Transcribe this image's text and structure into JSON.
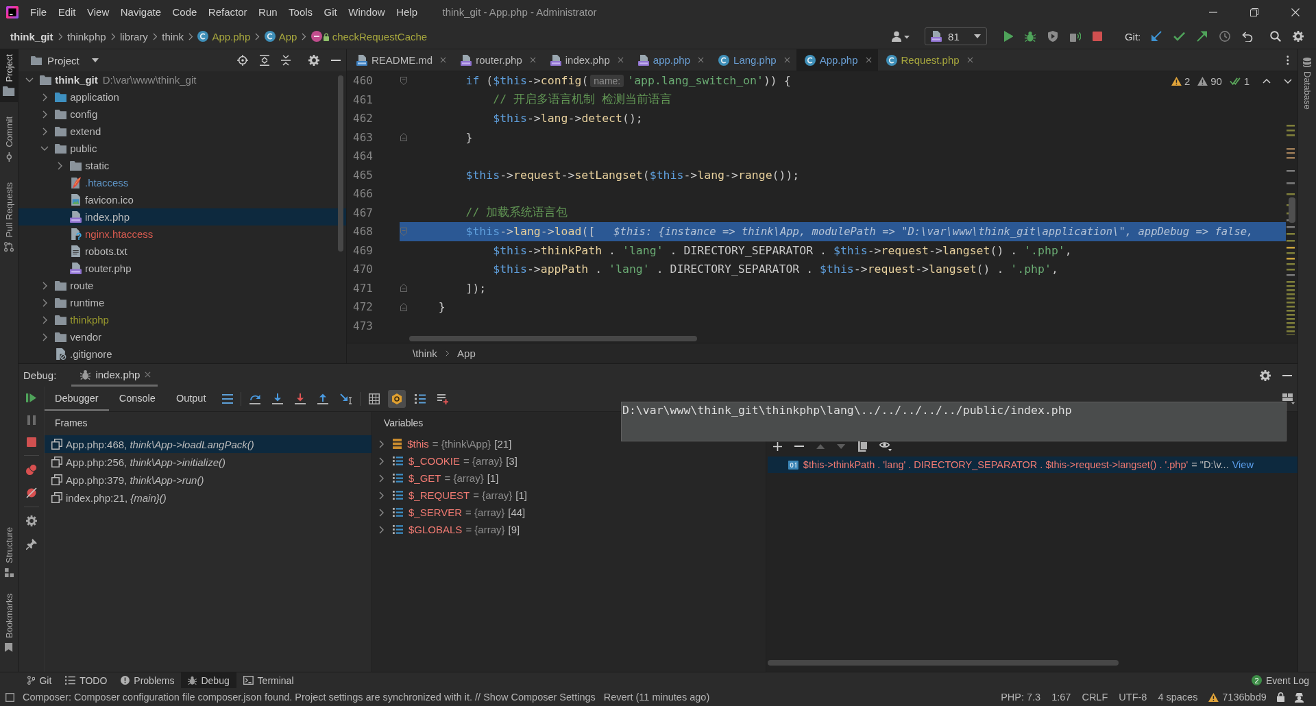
{
  "title_bar": {
    "menu": [
      "File",
      "Edit",
      "View",
      "Navigate",
      "Code",
      "Refactor",
      "Run",
      "Tools",
      "Git",
      "Window",
      "Help"
    ],
    "title": "think_git - App.php - Administrator"
  },
  "nav_bar": {
    "breadcrumbs": [
      {
        "label": "think_git",
        "kind": "project",
        "color": "#d4d4d4"
      },
      {
        "label": "thinkphp",
        "kind": "folder",
        "color": "#bbbbbb"
      },
      {
        "label": "library",
        "kind": "folder",
        "color": "#bbbbbb"
      },
      {
        "label": "think",
        "kind": "folder",
        "color": "#bbbbbb"
      },
      {
        "label": "App.php",
        "kind": "class",
        "color": "#a8a83e"
      },
      {
        "label": "App",
        "kind": "class",
        "color": "#a8a83e"
      },
      {
        "label": "checkRequestCache",
        "kind": "method",
        "color": "#a8a83e"
      }
    ],
    "run_config": "81",
    "vcs_label": "Git:"
  },
  "left_strip": {
    "top": [
      {
        "label": "Project",
        "selected": true
      },
      {
        "label": "Commit",
        "selected": false
      },
      {
        "label": "Pull Requests",
        "selected": false
      }
    ],
    "bottom": [
      {
        "label": "Structure",
        "selected": false
      },
      {
        "label": "Bookmarks",
        "selected": false
      }
    ]
  },
  "right_strip": [
    {
      "label": "Database",
      "selected": false
    }
  ],
  "project": {
    "title": "Project",
    "tree": [
      {
        "label": "think_git",
        "path": "D:\\var\\www\\think_git",
        "kind": "project",
        "color": "#d4d4d4",
        "selected": false,
        "expanded": true,
        "children": [
          {
            "label": "application",
            "kind": "source-folder",
            "color": "#bbbbbb",
            "selected": false,
            "expanded": false
          },
          {
            "label": "config",
            "kind": "folder",
            "color": "#bbbbbb",
            "selected": false,
            "expanded": false
          },
          {
            "label": "extend",
            "kind": "folder",
            "color": "#bbbbbb",
            "selected": false,
            "expanded": false
          },
          {
            "label": "public",
            "kind": "folder",
            "color": "#bbbbbb",
            "selected": false,
            "expanded": true,
            "children": [
              {
                "label": "static",
                "kind": "folder",
                "color": "#bbbbbb",
                "selected": false,
                "expanded": false
              },
              {
                "label": ".htaccess",
                "kind": "apache-config",
                "color": "#5f96c8",
                "selected": false
              },
              {
                "label": "favicon.ico",
                "kind": "image",
                "color": "#bbbbbb",
                "selected": false
              },
              {
                "label": "index.php",
                "kind": "php",
                "color": "#bbbbbb",
                "selected": true
              },
              {
                "label": "nginx.htaccess",
                "kind": "unknown",
                "color": "#d95b50",
                "selected": false
              },
              {
                "label": "robots.txt",
                "kind": "text",
                "color": "#bbbbbb",
                "selected": false
              },
              {
                "label": "router.php",
                "kind": "php",
                "color": "#bbbbbb",
                "selected": false
              }
            ]
          },
          {
            "label": "route",
            "kind": "folder",
            "color": "#bbbbbb",
            "selected": false,
            "expanded": false
          },
          {
            "label": "runtime",
            "kind": "folder",
            "color": "#bbbbbb",
            "selected": false,
            "expanded": false
          },
          {
            "label": "thinkphp",
            "kind": "folder",
            "color": "#9a9a2e",
            "selected": false,
            "expanded": false
          },
          {
            "label": "vendor",
            "kind": "folder",
            "color": "#bbbbbb",
            "selected": false,
            "expanded": false
          },
          {
            "label": ".gitignore",
            "kind": "ignore",
            "color": "#bbbbbb",
            "selected": false
          }
        ]
      }
    ]
  },
  "editor": {
    "tabs": [
      {
        "label": "README.md",
        "kind": "markdown",
        "color": "#bbbbbb",
        "selected": false
      },
      {
        "label": "router.php",
        "kind": "php",
        "color": "#bbbbbb",
        "selected": false
      },
      {
        "label": "index.php",
        "kind": "php",
        "color": "#bbbbbb",
        "selected": false
      },
      {
        "label": "app.php",
        "kind": "php",
        "color": "#6a9fd4",
        "selected": false
      },
      {
        "label": "Lang.php",
        "kind": "class",
        "color": "#6a9fd4",
        "selected": false
      },
      {
        "label": "App.php",
        "kind": "class",
        "color": "#6a9fd4",
        "selected": true
      },
      {
        "label": "Request.php",
        "kind": "class",
        "color": "#a8a83e",
        "selected": false
      }
    ],
    "code": [
      {
        "children": [
          {
            "number": "460",
            "current": false,
            "fold_end": false,
            "tokens": [
              {
                "kind": "keyword",
                "text": "if"
              },
              {
                "kind": "punct",
                "text": " ("
              },
              {
                "kind": "variable",
                "text": "$this"
              },
              {
                "kind": "arrow",
                "text": "->"
              },
              {
                "kind": "member",
                "text": "config"
              },
              {
                "kind": "punct",
                "text": "("
              },
              {
                "kind": "hint",
                "text": "name:"
              },
              {
                "kind": "string",
                "text": "'app.lang_switch_on'"
              },
              {
                "kind": "punct",
                "text": ")) {"
              }
            ],
            "children": [
              {
                "number": "461",
                "current": false,
                "fold_end": false,
                "tokens": [
                  {
                    "kind": "comment",
                    "text": "// 开启多语言机制 检测当前语言"
                  }
                ]
              },
              {
                "number": "462",
                "current": false,
                "fold_end": false,
                "tokens": [
                  {
                    "kind": "variable",
                    "text": "$this"
                  },
                  {
                    "kind": "arrow",
                    "text": "->"
                  },
                  {
                    "kind": "member",
                    "text": "lang"
                  },
                  {
                    "kind": "arrow",
                    "text": "->"
                  },
                  {
                    "kind": "member",
                    "text": "detect"
                  },
                  {
                    "kind": "punct",
                    "text": "();"
                  }
                ]
              }
            ]
          },
          {
            "number": "463",
            "current": false,
            "fold_end": true,
            "tokens": [
              {
                "kind": "punct",
                "text": "}"
              }
            ]
          },
          {
            "number": "464",
            "current": false,
            "fold_end": false
          },
          {
            "number": "465",
            "current": false,
            "fold_end": false,
            "tokens": [
              {
                "kind": "variable",
                "text": "$this"
              },
              {
                "kind": "arrow",
                "text": "->"
              },
              {
                "kind": "member",
                "text": "request"
              },
              {
                "kind": "arrow",
                "text": "->"
              },
              {
                "kind": "member",
                "text": "setLangset"
              },
              {
                "kind": "punct",
                "text": "("
              },
              {
                "kind": "variable",
                "text": "$this"
              },
              {
                "kind": "arrow",
                "text": "->"
              },
              {
                "kind": "member",
                "text": "lang"
              },
              {
                "kind": "arrow",
                "text": "->"
              },
              {
                "kind": "member",
                "text": "range"
              },
              {
                "kind": "punct",
                "text": "());"
              }
            ]
          },
          {
            "number": "466",
            "current": false,
            "fold_end": false
          },
          {
            "number": "467",
            "current": false,
            "fold_end": false,
            "tokens": [
              {
                "kind": "comment",
                "text": "// 加载系统语言包"
              }
            ]
          },
          {
            "number": "468",
            "current": true,
            "fold_end": false,
            "tokens": [
              {
                "kind": "variable",
                "text": "$this"
              },
              {
                "kind": "arrow",
                "text": "->"
              },
              {
                "kind": "member",
                "text": "lang"
              },
              {
                "kind": "arrow",
                "text": "->"
              },
              {
                "kind": "member",
                "text": "load"
              },
              {
                "kind": "punct",
                "text": "(["
              }
            ],
            "inline_value": "$this: {instance => think\\App, modulePath => \"D:\\var\\www\\think_git\\application\\\", appDebug => false,",
            "children": [
              {
                "number": "469",
                "current": false,
                "fold_end": false,
                "tokens": [
                  {
                    "kind": "variable",
                    "text": "$this"
                  },
                  {
                    "kind": "arrow",
                    "text": "->"
                  },
                  {
                    "kind": "member",
                    "text": "thinkPath"
                  },
                  {
                    "kind": "punct",
                    "text": " . "
                  },
                  {
                    "kind": "string",
                    "text": "'lang'"
                  },
                  {
                    "kind": "punct",
                    "text": " . "
                  },
                  {
                    "kind": "const",
                    "text": "DIRECTORY_SEPARATOR"
                  },
                  {
                    "kind": "punct",
                    "text": " . "
                  },
                  {
                    "kind": "variable",
                    "text": "$this"
                  },
                  {
                    "kind": "arrow",
                    "text": "->"
                  },
                  {
                    "kind": "member",
                    "text": "request"
                  },
                  {
                    "kind": "arrow",
                    "text": "->"
                  },
                  {
                    "kind": "member",
                    "text": "langset"
                  },
                  {
                    "kind": "punct",
                    "text": "() . "
                  },
                  {
                    "kind": "string",
                    "text": "'.php'"
                  },
                  {
                    "kind": "punct",
                    "text": ","
                  }
                ]
              },
              {
                "number": "470",
                "current": false,
                "fold_end": false,
                "tokens": [
                  {
                    "kind": "variable",
                    "text": "$this"
                  },
                  {
                    "kind": "arrow",
                    "text": "->"
                  },
                  {
                    "kind": "member",
                    "text": "appPath"
                  },
                  {
                    "kind": "punct",
                    "text": " . "
                  },
                  {
                    "kind": "string",
                    "text": "'lang'"
                  },
                  {
                    "kind": "punct",
                    "text": " . "
                  },
                  {
                    "kind": "const",
                    "text": "DIRECTORY_SEPARATOR"
                  },
                  {
                    "kind": "punct",
                    "text": " . "
                  },
                  {
                    "kind": "variable",
                    "text": "$this"
                  },
                  {
                    "kind": "arrow",
                    "text": "->"
                  },
                  {
                    "kind": "member",
                    "text": "request"
                  },
                  {
                    "kind": "arrow",
                    "text": "->"
                  },
                  {
                    "kind": "member",
                    "text": "langset"
                  },
                  {
                    "kind": "punct",
                    "text": "() . "
                  },
                  {
                    "kind": "string",
                    "text": "'.php'"
                  },
                  {
                    "kind": "punct",
                    "text": ","
                  }
                ]
              }
            ]
          },
          {
            "number": "471",
            "current": false,
            "fold_end": true,
            "tokens": [
              {
                "kind": "punct",
                "text": "]);"
              }
            ]
          }
        ]
      },
      {
        "number": "472",
        "current": false,
        "fold_end": true,
        "tokens": [
          {
            "kind": "punct",
            "text": "}"
          }
        ]
      },
      {
        "number": "473",
        "current": false,
        "fold_end": false
      }
    ],
    "inspections": [
      {
        "kind": "warning",
        "count": "2"
      },
      {
        "kind": "weak-warning",
        "count": "90"
      },
      {
        "kind": "typo",
        "count": "1"
      }
    ],
    "breadcrumb": [
      "\\think",
      "App"
    ]
  },
  "debug": {
    "title": "Debug:",
    "session": {
      "label": "index.php",
      "selected": true
    },
    "tabs": [
      {
        "label": "Debugger",
        "selected": true
      },
      {
        "label": "Console",
        "selected": false
      },
      {
        "label": "Output",
        "selected": false
      }
    ],
    "toolbar_toggle": {
      "on": true
    },
    "frames": {
      "title": "Frames",
      "items": [
        {
          "text": "App.php:468, *think\\App->loadLangPack()*",
          "selected": true
        },
        {
          "text": "App.php:256, *think\\App->initialize()*",
          "selected": false
        },
        {
          "text": "App.php:379, *think\\App->run()*",
          "selected": false
        },
        {
          "text": "index.php:21, *{main}()*",
          "selected": false
        }
      ]
    },
    "variables": {
      "title": "Variables",
      "items": [
        {
          "name": "$this",
          "value": "= {think\\App}",
          "size": "[21]",
          "kind": "object",
          "expanded": false
        },
        {
          "name": "$_COOKIE",
          "value": "= {array}",
          "size": "[3]",
          "kind": "array",
          "expanded": false
        },
        {
          "name": "$_GET",
          "value": "= {array}",
          "size": "[1]",
          "kind": "array",
          "expanded": false
        },
        {
          "name": "$_REQUEST",
          "value": "= {array}",
          "size": "[1]",
          "kind": "array",
          "expanded": false
        },
        {
          "name": "$_SERVER",
          "value": "= {array}",
          "size": "[44]",
          "kind": "array",
          "expanded": false
        },
        {
          "name": "$GLOBALS",
          "value": "= {array}",
          "size": "[9]",
          "kind": "array",
          "expanded": false
        }
      ]
    },
    "popup": "D:\\var\\www\\think_git\\thinkphp\\lang\\../../../../../public/index.php",
    "watches": [
      {
        "expression": "$this->thinkPath . 'lang' . DIRECTORY_SEPARATOR . $this->request->langset() . '.php'",
        "value": "= \"D:\\v...",
        "link": "View",
        "selected": true
      }
    ]
  },
  "tool_windows": [
    {
      "label": "Git",
      "selected": false
    },
    {
      "label": "TODO",
      "selected": false
    },
    {
      "label": "Problems",
      "selected": false
    },
    {
      "label": "Debug",
      "selected": true
    },
    {
      "label": "Terminal",
      "selected": false
    }
  ],
  "event_log": {
    "label": "Event Log",
    "badge": "2"
  },
  "status_bar": {
    "message": "Composer: Composer configuration file composer.json found. Project settings are synchronized with it. // Show Composer Settings",
    "revert": "Revert (11 minutes ago)",
    "widgets": [
      "PHP: 7.3",
      "1:67",
      "CRLF",
      "UTF-8",
      "4 spaces"
    ],
    "vcs_revision": "7136bbd9"
  }
}
